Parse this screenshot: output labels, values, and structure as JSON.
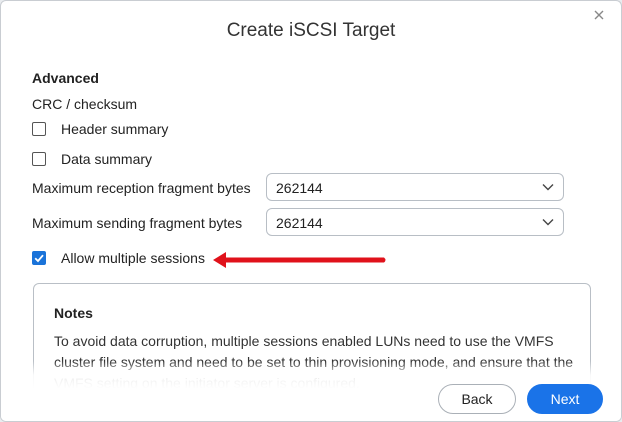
{
  "dialog": {
    "title": "Create iSCSI Target"
  },
  "advanced": {
    "section_title": "Advanced",
    "crc_label": "CRC / checksum",
    "header_summary": {
      "label": "Header summary",
      "checked": false
    },
    "data_summary": {
      "label": "Data summary",
      "checked": false
    },
    "max_reception": {
      "label": "Maximum reception fragment bytes",
      "value": "262144"
    },
    "max_sending": {
      "label": "Maximum sending fragment bytes",
      "value": "262144"
    },
    "allow_multiple_sessions": {
      "label": "Allow multiple sessions",
      "checked": true
    }
  },
  "notes": {
    "title": "Notes",
    "text": "To avoid data corruption, multiple sessions enabled LUNs need to use the VMFS cluster file system and need to be set to thin provisioning mode, and ensure that the VMFS setting on the initiator server is configured."
  },
  "footer": {
    "back_label": "Back",
    "next_label": "Next"
  },
  "colors": {
    "accent": "#1a73e8",
    "annotation_arrow": "#e0121b"
  },
  "icons": {
    "close": "close-icon",
    "dropdown": "chevron-down-icon",
    "check": "check-icon",
    "annotation": "annotation-arrow-icon"
  }
}
